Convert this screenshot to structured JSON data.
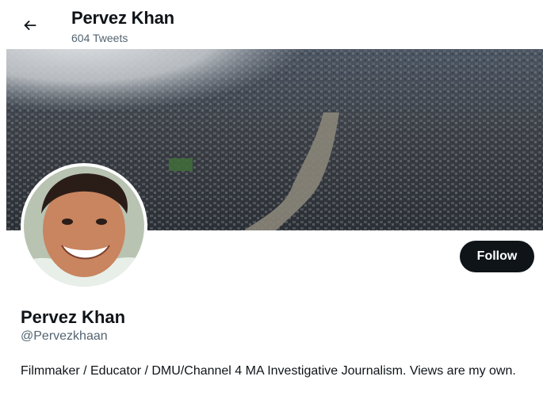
{
  "header": {
    "title": "Pervez Khan",
    "tweet_count": "604 Tweets"
  },
  "icons": {
    "back": "arrow-left-icon"
  },
  "profile": {
    "display_name": "Pervez Khan",
    "handle": "@Pervezkhaan",
    "bio": "Filmmaker / Educator / DMU/Channel 4 MA Investigative Journalism. Views are my own."
  },
  "actions": {
    "follow_label": "Follow"
  },
  "colors": {
    "text": "#0f1419",
    "secondary_text": "#536471",
    "follow_bg": "#0f1419",
    "background": "#ffffff"
  }
}
